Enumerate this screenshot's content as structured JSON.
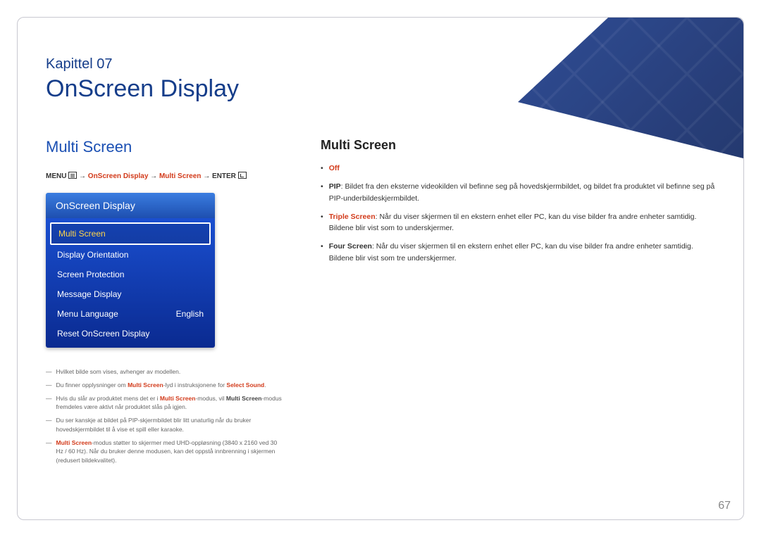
{
  "chapter": "Kapittel  07",
  "title": "OnScreen Display",
  "left_heading": "Multi Screen",
  "right_heading": "Multi Screen",
  "breadcrumb": {
    "menu": "MENU",
    "p1": "OnScreen Display",
    "p2": "Multi Screen",
    "enter": "ENTER"
  },
  "osd": {
    "header": "OnScreen Display",
    "items": [
      {
        "label": "Multi Screen",
        "value": "",
        "selected": true
      },
      {
        "label": "Display Orientation",
        "value": ""
      },
      {
        "label": "Screen Protection",
        "value": ""
      },
      {
        "label": "Message Display",
        "value": ""
      },
      {
        "label": "Menu Language",
        "value": "English"
      },
      {
        "label": "Reset OnScreen Display",
        "value": ""
      }
    ]
  },
  "notes": [
    {
      "plain_full": "Hvilket bilde som vises, avhenger av modellen."
    },
    {
      "pre": "Du finner opplysninger om ",
      "red1": "Multi Screen",
      "mid": "-lyd i instruksjonene for ",
      "red2": "Select Sound",
      "post": "."
    },
    {
      "pre": "Hvis du slår av produktet mens det er i ",
      "red1": "Multi Screen",
      "mid": "-modus, vil ",
      "bold1": "Multi Screen",
      "post": "-modus fremdeles være aktivt når produktet slås på igjen."
    },
    {
      "plain_full": "Du ser kanskje at bildet på PIP-skjermbildet blir litt unaturlig når du bruker hovedskjermbildet til å vise et spill eller karaoke."
    },
    {
      "red1": "Multi Screen",
      "post": "-modus støtter to skjermer med UHD-oppløsning (3840 x 2160 ved 30 Hz / 60 Hz). Når du bruker denne modusen, kan det oppstå innbrenning i skjermen (redusert bildekvalitet)."
    }
  ],
  "options": [
    {
      "label": "Off",
      "redlabel": true,
      "text": ""
    },
    {
      "label": "PIP",
      "text": ": Bildet fra den eksterne videokilden vil befinne seg på hovedskjermbildet, og bildet fra produktet vil befinne seg på PIP-underbildeskjermbildet."
    },
    {
      "label": "Triple Screen",
      "redlabel": true,
      "text": ": Når du viser skjermen til en ekstern enhet eller PC, kan du vise bilder fra andre enheter samtidig. Bildene blir vist som to underskjermer."
    },
    {
      "label": "Four Screen",
      "text": ": Når du viser skjermen til en ekstern enhet eller PC, kan du vise bilder fra andre enheter samtidig. Bildene blir vist som tre underskjermer."
    }
  ],
  "page_number": "67"
}
